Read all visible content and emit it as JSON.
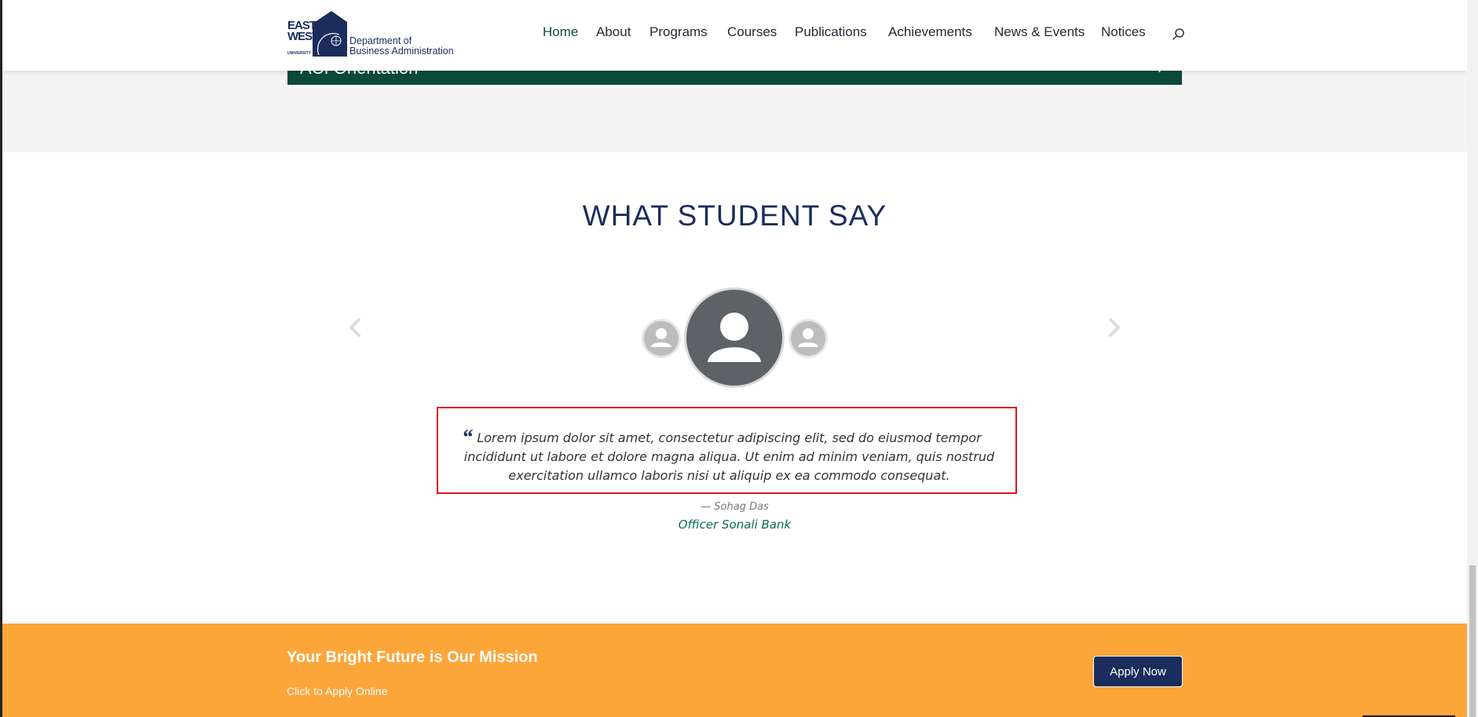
{
  "header": {
    "logo": {
      "east": "EAST",
      "west": "WEST",
      "university": "UNIVERSITY",
      "dept_line1": "Department of",
      "dept_line2": "Business Administration"
    },
    "nav": [
      {
        "label": "Home",
        "active": true
      },
      {
        "label": "About"
      },
      {
        "label": "Programs"
      },
      {
        "label": "Courses"
      },
      {
        "label": "Publications"
      },
      {
        "label": "Achievements"
      },
      {
        "label": "News & Events"
      },
      {
        "label": "Notices"
      }
    ],
    "search_icon": "search-icon"
  },
  "accordion": {
    "partial_title": "ACI Orientation",
    "toggle_symbol": "+"
  },
  "testimonials": {
    "title": "WHAT STUDENT SAY",
    "quote": "Lorem ipsum dolor sit amet, consectetur adipiscing elit, sed do eiusmod tempor incididunt ut labore et dolore magna aliqua. Ut enim ad minim veniam, quis nostrud exercitation ullamco laboris nisi ut aliquip ex ea commodo consequat.",
    "quote_mark": "“",
    "author": "— Sohag Das",
    "role": "Officer Sonali Bank"
  },
  "cta": {
    "title": "Your Bright Future is Our Mission",
    "subtitle": "Click to Apply Online",
    "button": "Apply Now"
  },
  "colors": {
    "brand_navy": "#1b2d5c",
    "brand_green": "#0b4a3b",
    "cta_orange": "#fca63a",
    "highlight_red": "#e0141b"
  }
}
